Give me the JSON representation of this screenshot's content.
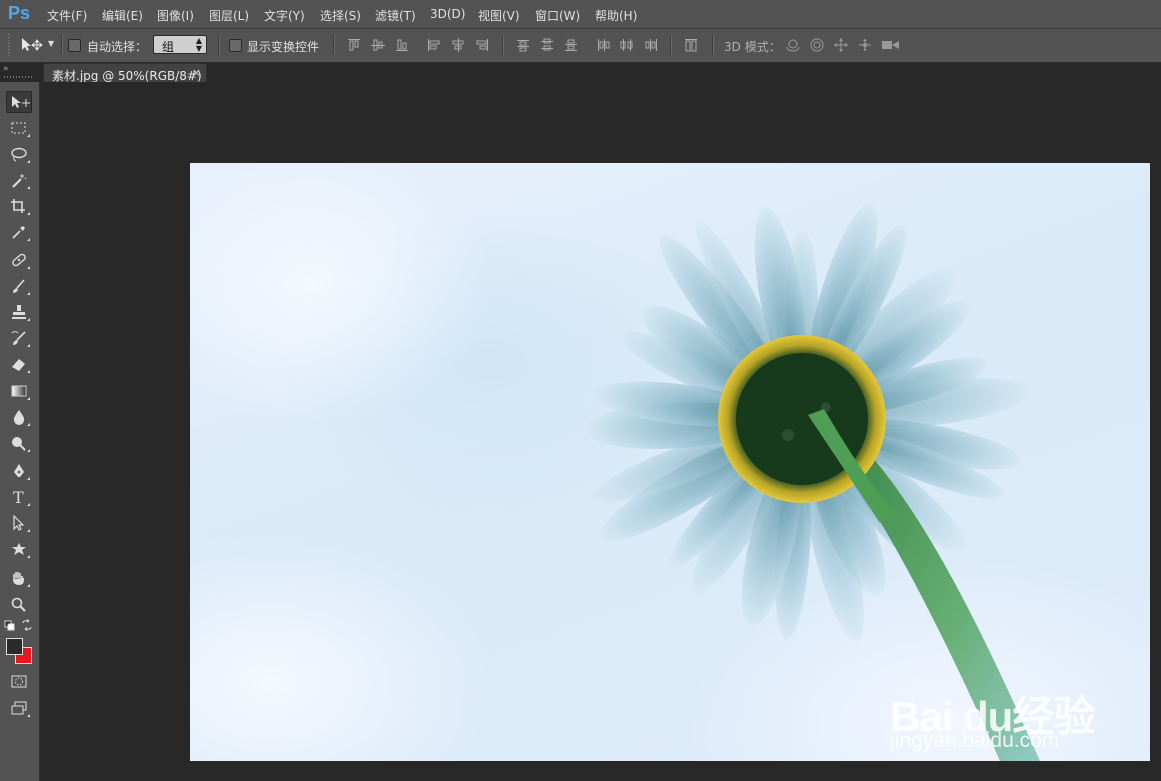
{
  "app": {
    "logo": "Ps"
  },
  "menu": [
    "文件(F)",
    "编辑(E)",
    "图像(I)",
    "图层(L)",
    "文字(Y)",
    "选择(S)",
    "滤镜(T)",
    "3D(D)",
    "视图(V)",
    "窗口(W)",
    "帮助(H)"
  ],
  "options": {
    "auto_select_label": "自动选择：",
    "auto_select_checked": false,
    "auto_select_value": "组",
    "show_transform_label": "显示变换控件",
    "show_transform_checked": false,
    "mode_3d_label": "3D 模式："
  },
  "document": {
    "tab_label": "素材.jpg @ 50%(RGB/8#)",
    "close_glyph": "×"
  },
  "colors": {
    "foreground": "#2a2a2a",
    "background": "#e5191e",
    "ui_panel": "#535353",
    "workspace": "#282828",
    "logo_blue": "#4fa9e8"
  },
  "tools": [
    "move-tool",
    "marquee-tool",
    "lasso-tool",
    "magic-wand-tool",
    "crop-tool",
    "eyedropper-tool",
    "healing-brush-tool",
    "brush-tool",
    "clone-stamp-tool",
    "history-brush-tool",
    "eraser-tool",
    "gradient-tool",
    "blur-tool",
    "dodge-tool",
    "pen-tool",
    "type-tool",
    "path-selection-tool",
    "custom-shape-tool",
    "hand-tool",
    "zoom-tool"
  ],
  "watermark": {
    "logo_text": "Bai du经验",
    "url": "jingyan.baidu.com"
  }
}
